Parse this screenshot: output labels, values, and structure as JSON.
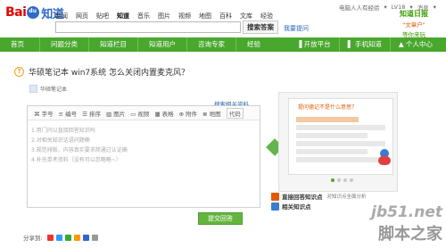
{
  "header": {
    "logo_bai": "Bai",
    "logo_zhi": "知道",
    "nav": [
      "新闻",
      "网页",
      "贴吧",
      "知道",
      "音乐",
      "图片",
      "视频",
      "地图",
      "百科",
      "文库",
      "经验"
    ],
    "nav_active": "知道",
    "search_button": "搜索答案",
    "ask_link": "我要提问",
    "user_bar": [
      "电脑人人有经验",
      "▾",
      "LV18",
      "▾",
      "消息",
      "▾"
    ],
    "banner": {
      "line1": "知道日报",
      "line2": "\"文章户\"",
      "line3": "等你来玩"
    }
  },
  "green_nav": {
    "items": [
      "首页",
      "问题分类",
      "知道栏目",
      "知道用户",
      "咨询专家",
      "经验"
    ],
    "right": [
      "▐ 开放平台",
      "▌ 手机知道",
      "▲ 个人中心"
    ]
  },
  "question": {
    "title": "华硕笔记本 win7系统 怎么关闭内置麦克风？",
    "author": "华硕笔记本"
  },
  "editor": {
    "toolbar": [
      "⌘ 字号",
      "≡ 编号",
      "☰ 排序",
      "▧ 图片",
      "▭ 视频",
      "▦ 表格",
      "⊕ 附件",
      "≣ 地图"
    ],
    "code_select": "代码",
    "hints": [
      "1.用门问以直接回答知识吗",
      "2.对相关知识话语问题确",
      "3.规范排版，内容真实要求简通过认证确",
      "4.补充单考资料（没有可以忽略略~）"
    ],
    "ref_link": "搜索相关资料",
    "submit": "提交回答"
  },
  "share": {
    "label": "分享到:"
  },
  "right_card": {
    "title": "提问德记不是什么意思？",
    "pager": [
      true,
      false,
      false,
      false
    ]
  },
  "links": [
    {
      "title": "直接回答知识点",
      "desc": "对知识点全面分析"
    },
    {
      "title": "相关知识点",
      "desc": ""
    }
  ],
  "watermark": {
    "w1": "jb51.net",
    "w2": "脚本之家",
    "w3": ""
  }
}
